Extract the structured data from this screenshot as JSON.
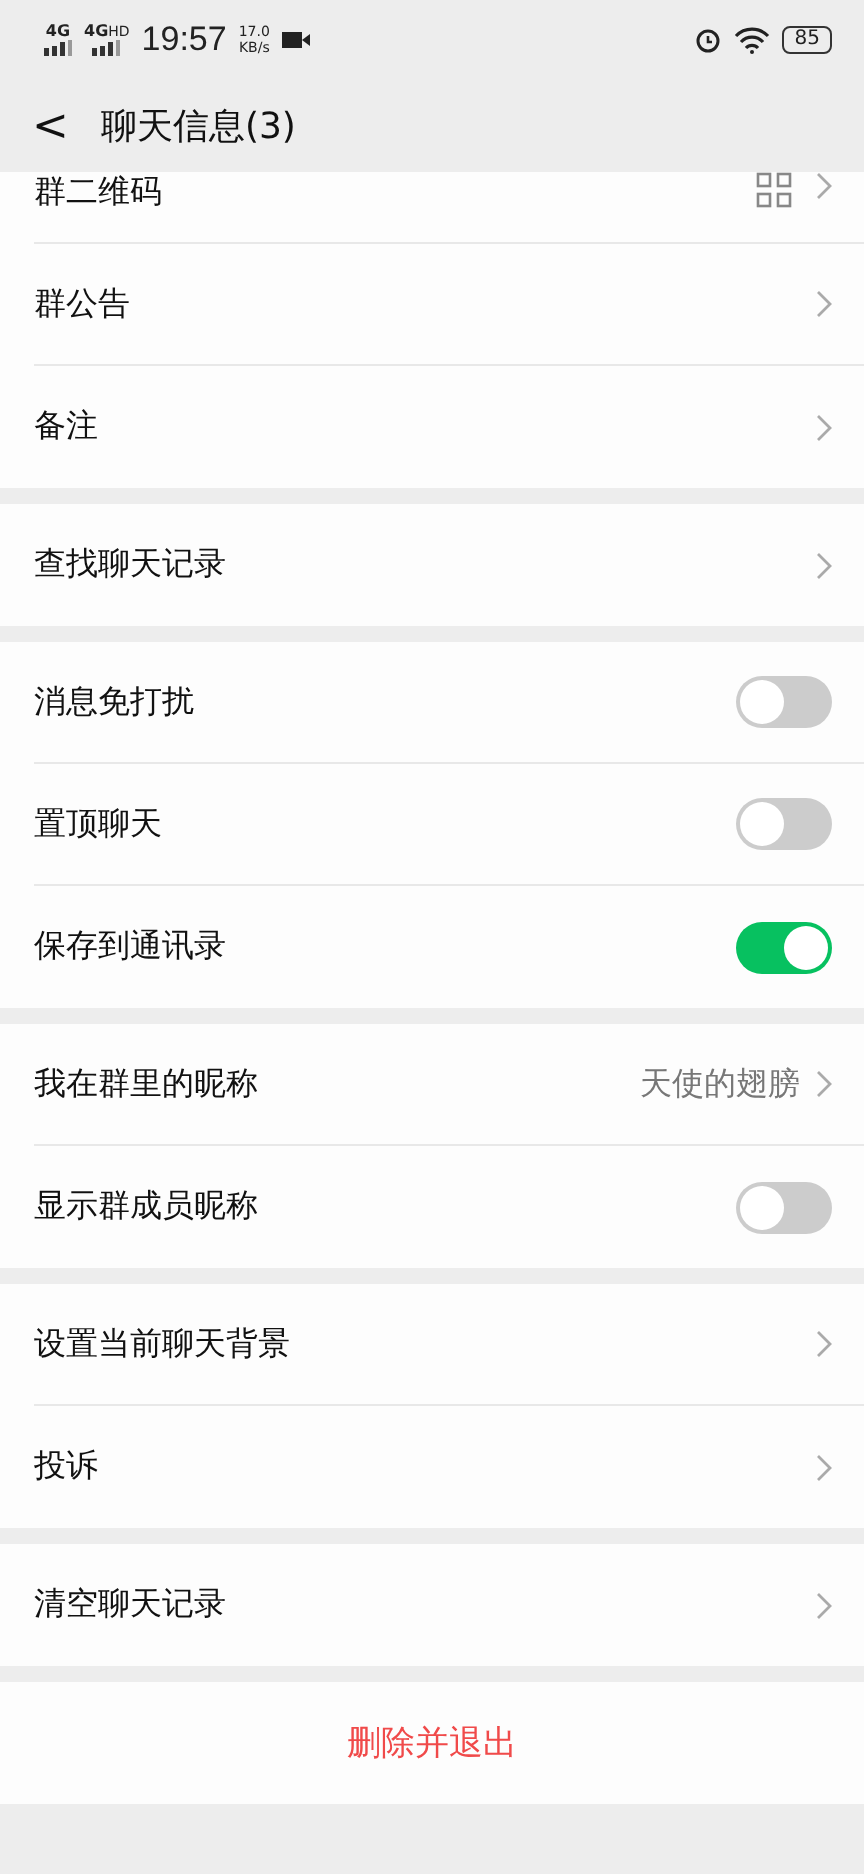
{
  "status_bar": {
    "sim1": "4G",
    "sim2": "4G",
    "sim2_badge": "HD",
    "time": "19:57",
    "speed": "17.0",
    "speed_unit": "KB/s",
    "battery": "85"
  },
  "header": {
    "back": "<",
    "title": "聊天信息(3)"
  },
  "groups": [
    {
      "items": [
        {
          "kind": "qr",
          "label": "群二维码"
        },
        {
          "kind": "link",
          "label": "群公告"
        },
        {
          "kind": "link",
          "label": "备注"
        }
      ]
    },
    {
      "items": [
        {
          "kind": "link",
          "label": "查找聊天记录"
        }
      ]
    },
    {
      "items": [
        {
          "kind": "toggle",
          "label": "消息免打扰",
          "on": false
        },
        {
          "kind": "toggle",
          "label": "置顶聊天",
          "on": false
        },
        {
          "kind": "toggle",
          "label": "保存到通讯录",
          "on": true
        }
      ]
    },
    {
      "items": [
        {
          "kind": "link",
          "label": "我在群里的昵称",
          "value": "天使的翅膀"
        },
        {
          "kind": "toggle",
          "label": "显示群成员昵称",
          "on": false
        }
      ]
    },
    {
      "items": [
        {
          "kind": "link",
          "label": "设置当前聊天背景"
        },
        {
          "kind": "link",
          "label": "投诉"
        }
      ]
    },
    {
      "items": [
        {
          "kind": "link",
          "label": "清空聊天记录"
        }
      ]
    }
  ],
  "danger_button": "删除并退出"
}
